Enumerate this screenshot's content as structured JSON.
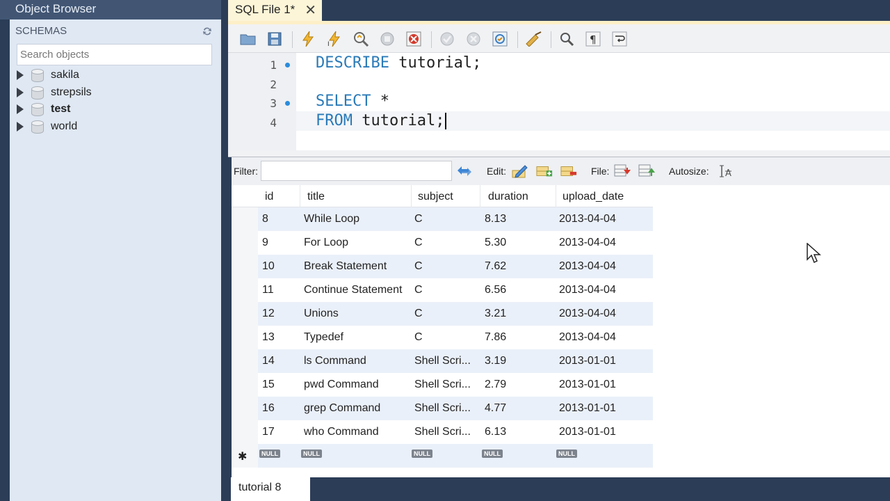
{
  "object_browser": {
    "title": "Object Browser",
    "schemas_label": "SCHEMAS",
    "search_placeholder": "Search objects",
    "schemas": [
      {
        "name": "sakila",
        "bold": false
      },
      {
        "name": "strepsils",
        "bold": false
      },
      {
        "name": "test",
        "bold": true
      },
      {
        "name": "world",
        "bold": false
      }
    ]
  },
  "editor_tab": {
    "label": "SQL File 1*",
    "close": "✕"
  },
  "editor": {
    "line_numbers": [
      "1",
      "2",
      "3",
      "4"
    ],
    "lines": {
      "l1_kw": "DESCRIBE",
      "l1_rest": " tutorial;",
      "l3_kw": "SELECT",
      "l3_rest": " *",
      "l4_kw": "FROM",
      "l4_rest": " tutorial;"
    }
  },
  "result_toolbar": {
    "filter_label": "Filter:",
    "edit_label": "Edit:",
    "file_label": "File:",
    "autosize_label": "Autosize:"
  },
  "grid": {
    "columns": [
      "id",
      "title",
      "subject",
      "duration",
      "upload_date"
    ],
    "rows": [
      [
        "8",
        "While Loop",
        "C",
        "8.13",
        "2013-04-04"
      ],
      [
        "9",
        "For Loop",
        "C",
        "5.30",
        "2013-04-04"
      ],
      [
        "10",
        "Break Statement",
        "C",
        "7.62",
        "2013-04-04"
      ],
      [
        "11",
        "Continue Statement",
        "C",
        "6.56",
        "2013-04-04"
      ],
      [
        "12",
        "Unions",
        "C",
        "3.21",
        "2013-04-04"
      ],
      [
        "13",
        "Typedef",
        "C",
        "7.86",
        "2013-04-04"
      ],
      [
        "14",
        "ls Command",
        "Shell Scri...",
        "3.19",
        "2013-01-01"
      ],
      [
        "15",
        "pwd Command",
        "Shell Scri...",
        "2.79",
        "2013-01-01"
      ],
      [
        "16",
        "grep Command",
        "Shell Scri...",
        "4.77",
        "2013-01-01"
      ],
      [
        "17",
        "who Command",
        "Shell Scri...",
        "6.13",
        "2013-01-01"
      ]
    ],
    "new_row_marker": "✱",
    "null_label": "NULL"
  },
  "result_tab": {
    "label": "tutorial 8"
  },
  "colors": {
    "keyword": "#2a7ab8",
    "sidebar_bg": "#dfe8f3",
    "alt_row": "#eaf0f9",
    "frame": "#2b3d57"
  }
}
